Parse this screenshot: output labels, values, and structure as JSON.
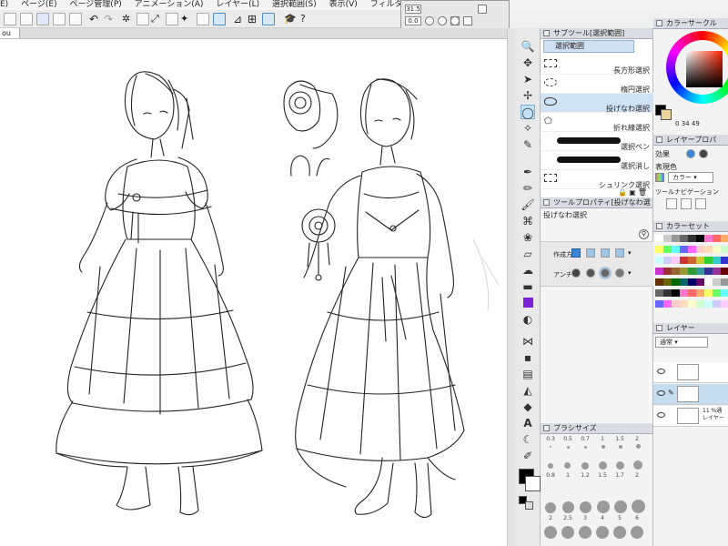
{
  "menu": [
    "E)",
    "ページ(E)",
    "ページ管理(P)",
    "アニメーション(A)",
    "レイヤー(L)",
    "選択範囲(S)",
    "表示(V)",
    "フィルター("
  ],
  "canvas_tab": "ou",
  "navigator": {
    "zoom": "31.5",
    "angle": "0.0"
  },
  "subtool": {
    "panel_title": "サブツール[選択範囲]",
    "group_button": "選択範囲",
    "items": [
      "長方形選択",
      "楕円選択",
      "投げなわ選択",
      "折れ線選択",
      "選択ペン",
      "選択消し",
      "シュリンク選択"
    ],
    "selected_index": 2
  },
  "tool_property": {
    "panel_title": "ツールプロパティ[投げなわ選",
    "tool_name": "投げなわ選択",
    "mode_label": "作成方",
    "aa_label": "アンチ"
  },
  "brush_size": {
    "panel_title": "ブラシサイズ",
    "rows": [
      [
        "0.3",
        "0.5",
        "0.7",
        "1",
        "1.5",
        "2"
      ],
      [
        "0.8",
        "1",
        "1.2",
        "1.5",
        "1.7",
        "2"
      ],
      [
        "2",
        "2.5",
        "3",
        "4",
        "5",
        "6"
      ]
    ]
  },
  "color_circle": {
    "panel_title": "カラーサークル",
    "h": "0",
    "s": "34",
    "v": "49"
  },
  "layer_property": {
    "panel_title": "レイヤープロパ",
    "effect_label": "効果",
    "display_color_label": "表現色",
    "display_color_value": "カラー",
    "tool_nav_label": "ツールナビゲーション"
  },
  "color_set": {
    "panel_title": "カラーセット"
  },
  "layers": {
    "panel_title": "レイヤー",
    "blend_mode": "通常",
    "rows": [
      {
        "name": "",
        "selected": false
      },
      {
        "name": "",
        "selected": true
      },
      {
        "name": "11 %通 レイヤー",
        "selected": false
      }
    ]
  },
  "colors": {
    "main": "#000000",
    "sub": "#ffffff",
    "accent": "#4a90d9",
    "violet": "#7b22d8"
  }
}
